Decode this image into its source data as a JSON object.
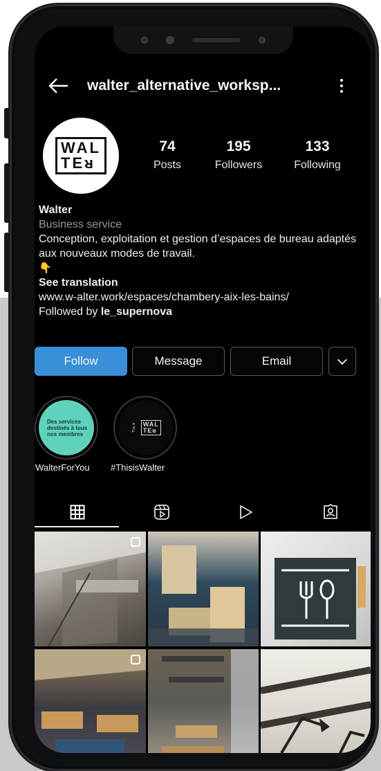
{
  "profile": {
    "username": "walter_alternative_worksp...",
    "logo_lines": [
      "WAL",
      "TEᴚ"
    ],
    "stats": [
      {
        "value": "74",
        "label": "Posts"
      },
      {
        "value": "195",
        "label": "Followers"
      },
      {
        "value": "133",
        "label": "Following"
      }
    ],
    "name": "Walter",
    "category": "Business service",
    "bio": "Conception, exploitation et gestion d’espaces de bureau adaptés aux nouveaux modes de travail.",
    "bio_emoji": "👇",
    "see_translation": "See translation",
    "link": "www.w-alter.work/espaces/chambery-aix-les-bains/",
    "followed_by_prefix": "Followed by ",
    "followed_by_user": "le_supernova"
  },
  "actions": {
    "follow": "Follow",
    "message": "Message",
    "email": "Email"
  },
  "highlights": [
    {
      "label": "#WalterForYou",
      "cover_lines": [
        "Des services",
        "destinés à tous",
        "nos membres"
      ],
      "cover_highlight_word": "tous"
    },
    {
      "label": "#ThisisWalter",
      "cover_side_text": "This is"
    }
  ],
  "tabs": [
    {
      "name": "grid",
      "icon": "grid-icon",
      "active": true
    },
    {
      "name": "reels",
      "icon": "reels-icon",
      "active": false
    },
    {
      "name": "videos",
      "icon": "play-icon",
      "active": false
    },
    {
      "name": "tagged",
      "icon": "tagged-icon",
      "active": false
    }
  ],
  "colors": {
    "follow_button": "#3a8fd9",
    "background": "#000000",
    "secondary_text": "#9a9a9a",
    "highlight_teal": "#5fd1bd"
  }
}
